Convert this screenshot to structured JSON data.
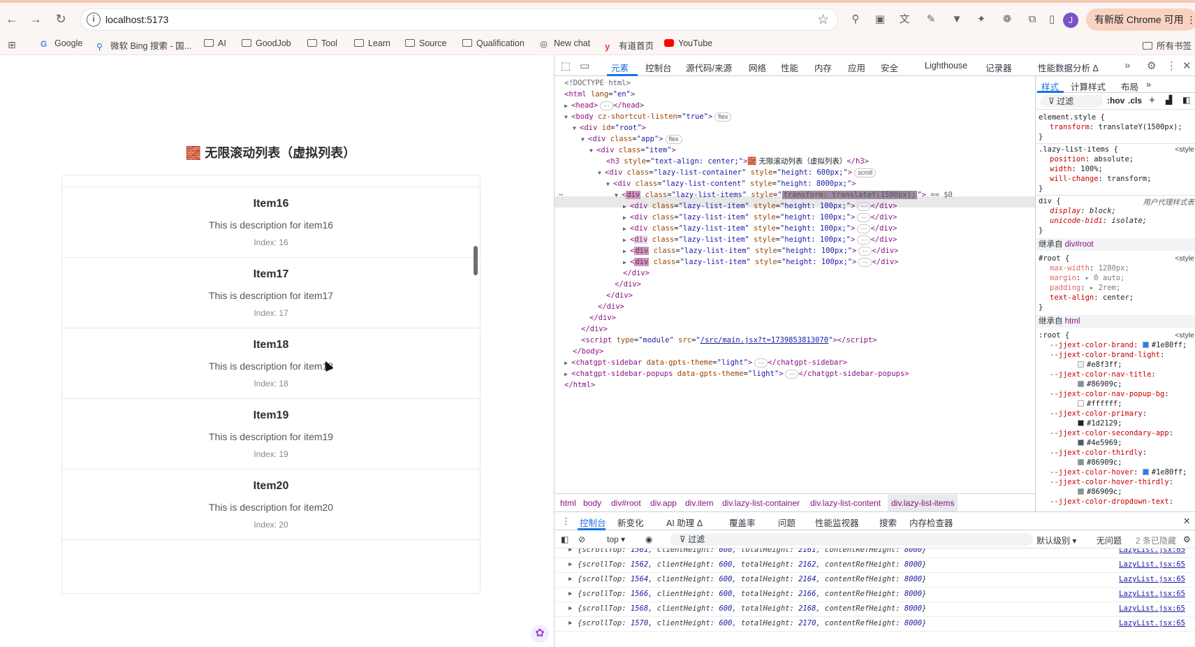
{
  "browser": {
    "url": "localhost:5173",
    "update_label": "有新版 Chrome 可用",
    "profile_initial": "J",
    "bookmarks": [
      "Google",
      "微软 Bing 搜索 - 国...",
      "AI",
      "GoodJob",
      "Tool",
      "Learn",
      "Source",
      "Qualification",
      "New chat",
      "有道首页",
      "YouTube"
    ],
    "all_bookmarks": "所有书签"
  },
  "page": {
    "title": "🧱 无限滚动列表（虚拟列表）",
    "items": [
      {
        "title": "Item16",
        "desc": "This is description for item16",
        "index": "Index: 16"
      },
      {
        "title": "Item17",
        "desc": "This is description for item17",
        "index": "Index: 17"
      },
      {
        "title": "Item18",
        "desc": "This is description for item18",
        "index": "Index: 18"
      },
      {
        "title": "Item19",
        "desc": "This is description for item19",
        "index": "Index: 19"
      },
      {
        "title": "Item20",
        "desc": "This is description for item20",
        "index": "Index: 20"
      }
    ]
  },
  "devtools": {
    "tabs": [
      "元素",
      "控制台",
      "源代码/来源",
      "网络",
      "性能",
      "内存",
      "应用",
      "安全",
      "Lighthouse",
      "记录器",
      "性能数据分析 Δ"
    ],
    "breadcrumbs": [
      "html",
      "body",
      "div#root",
      "div.app",
      "div.item",
      "div.lazy-list-container",
      "div.lazy-list-content",
      "div.lazy-list-items"
    ],
    "styles_tabs": [
      "样式",
      "计算样式",
      "布局"
    ],
    "filter_placeholder": "过滤",
    "hov": ":hov",
    "cls": ".cls",
    "drawer_tabs": [
      "控制台",
      "新变化",
      "AI 助理 Δ",
      "覆盖率",
      "问题",
      "性能监视器",
      "搜索",
      "内存检查器"
    ],
    "console_context": "top ▾",
    "console_filter": "过滤",
    "default_levels": "默认级别 ▾",
    "no_issues": "无问题",
    "hidden_count": "2 条已隐藏",
    "logs": [
      {
        "scrollTop": "1561",
        "totalHeight": "2161"
      },
      {
        "scrollTop": "1562",
        "totalHeight": "2162"
      },
      {
        "scrollTop": "1564",
        "totalHeight": "2164"
      },
      {
        "scrollTop": "1566",
        "totalHeight": "2166"
      },
      {
        "scrollTop": "1568",
        "totalHeight": "2168"
      },
      {
        "scrollTop": "1570",
        "totalHeight": "2170"
      }
    ],
    "log_client_height": "600",
    "log_content_height": "8000",
    "log_source": "LazyList.jsx:65"
  }
}
